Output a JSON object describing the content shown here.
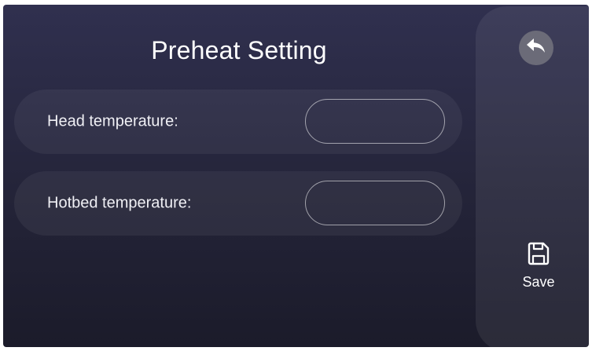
{
  "page": {
    "title": "Preheat Setting"
  },
  "fields": [
    {
      "label": "Head temperature:",
      "value": ""
    },
    {
      "label": "Hotbed temperature:",
      "value": ""
    }
  ],
  "side_panel": {
    "back_icon": "back-arrow-icon",
    "save_icon": "floppy-disk-icon",
    "save_label": "Save"
  },
  "colors": {
    "background_top": "#30304f",
    "background_bottom": "#1b1b2a",
    "text": "#ffffff",
    "back_button": "#6b6b78"
  }
}
